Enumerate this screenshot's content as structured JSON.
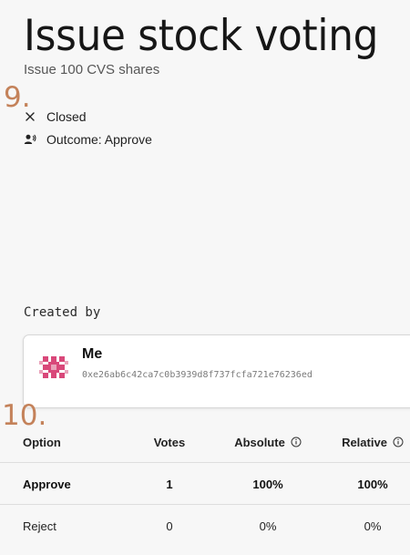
{
  "header": {
    "title": "Issue stock voting",
    "subtitle": "Issue 100 CVS shares"
  },
  "annotations": {
    "step_a": "9.",
    "step_b": "10."
  },
  "status": {
    "closed_label": "Closed",
    "closed_icon": "close-icon",
    "outcome_label": "Outcome: Approve",
    "outcome_icon": "voice-user-icon"
  },
  "creator": {
    "section_label": "Created by",
    "name": "Me",
    "address": "0xe26ab6c42ca7c0b3939d8f737fcfa721e76236ed",
    "avatar_icon": "identicon-avatar",
    "avatar_colors": [
      "#d9487a",
      "#e9a2ba"
    ]
  },
  "results": {
    "columns": {
      "option": "Option",
      "votes": "Votes",
      "absolute": "Absolute",
      "relative": "Relative"
    },
    "info_icon": "info-icon",
    "rows": [
      {
        "option": "Approve",
        "votes": "1",
        "absolute": "100%",
        "relative": "100%"
      },
      {
        "option": "Reject",
        "votes": "0",
        "absolute": "0%",
        "relative": "0%"
      }
    ]
  }
}
